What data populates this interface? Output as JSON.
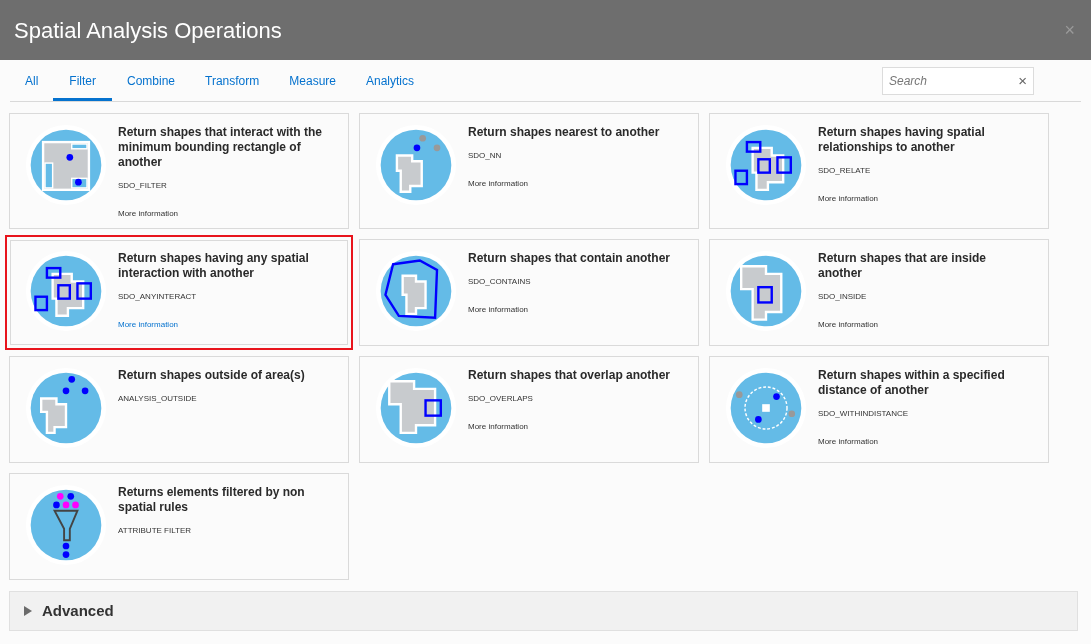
{
  "dialog": {
    "title": "Spatial Analysis Operations",
    "close": "×"
  },
  "tabs": [
    {
      "label": "All",
      "selected": false
    },
    {
      "label": "Filter",
      "selected": true
    },
    {
      "label": "Combine",
      "selected": false
    },
    {
      "label": "Transform",
      "selected": false
    },
    {
      "label": "Measure",
      "selected": false
    },
    {
      "label": "Analytics",
      "selected": false
    }
  ],
  "search": {
    "placeholder": "Search",
    "clear": "×"
  },
  "operations": [
    {
      "kind": "filter",
      "title": "Return shapes that interact with the minimum bounding rectangle of another",
      "code": "SDO_FILTER",
      "link": "More information",
      "selected": false
    },
    {
      "kind": "nearest",
      "title": "Return shapes nearest to another",
      "code": "SDO_NN",
      "link": "More information",
      "selected": false
    },
    {
      "kind": "relate",
      "title": "Return shapes having spatial relationships to another",
      "code": "SDO_RELATE",
      "link": "More information",
      "selected": false
    },
    {
      "kind": "anyinteract",
      "title": "Return shapes having any spatial interaction with another",
      "code": "SDO_ANYINTERACT",
      "link": "More information",
      "selected": true
    },
    {
      "kind": "contains",
      "title": "Return shapes that contain another",
      "code": "SDO_CONTAINS",
      "link": "More information",
      "selected": false
    },
    {
      "kind": "inside",
      "title": "Return shapes that are inside another",
      "code": "SDO_INSIDE",
      "link": "More information",
      "selected": false
    },
    {
      "kind": "outside",
      "title": "Return shapes outside of area(s)",
      "code": "ANALYSIS_OUTSIDE",
      "selected": false
    },
    {
      "kind": "overlaps",
      "title": "Return shapes that overlap another",
      "code": "SDO_OVERLAPS",
      "link": "More information",
      "selected": false
    },
    {
      "kind": "withindistance",
      "title": "Return shapes within a specified distance of another",
      "code": "SDO_WITHINDISTANCE",
      "link": "More information",
      "selected": false
    },
    {
      "kind": "attribute",
      "title": "Returns elements filtered by non spatial rules",
      "code": "ATTRIBUTE FILTER",
      "selected": false
    }
  ],
  "advanced": {
    "label": "Advanced",
    "expanded": false
  }
}
